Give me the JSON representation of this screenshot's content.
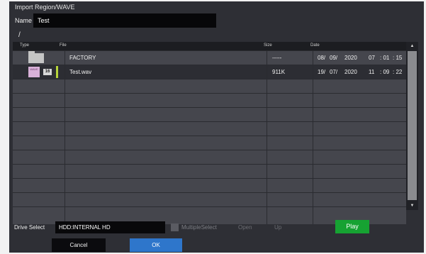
{
  "dialog": {
    "title": "Import Region/WAVE"
  },
  "name": {
    "label": "Name",
    "value": "Test"
  },
  "path": "/",
  "columns": {
    "type": "Type",
    "file": "File",
    "size": "Size",
    "date": "Date"
  },
  "files": [
    {
      "type_icon": "folder-icon",
      "name": "FACTORY",
      "size": "-----",
      "date": {
        "d": "08/",
        "m": "09/",
        "y": "2020",
        "hh": "07",
        "mm": ": 01",
        "ss": ": 15"
      }
    },
    {
      "type_icon": "wave-file-icon",
      "icon_label": "WAVE",
      "bits_badge": "16",
      "name": "Test.wav",
      "size": "911K",
      "date": {
        "d": "19/",
        "m": "07/",
        "y": "2020",
        "hh": "11",
        "mm": ": 09",
        "ss": ": 22"
      }
    }
  ],
  "scrollbar": {
    "up_icon": "arrow-up-icon",
    "down_icon": "arrow-down-icon",
    "up": "▲",
    "down": "▼"
  },
  "footer": {
    "drive_label": "Drive Select",
    "drive_value": "HDD:INTERNAL HD",
    "multiple_select": "MultipleSelect",
    "open": "Open",
    "up": "Up",
    "play": "Play",
    "cancel": "Cancel",
    "ok": "OK"
  },
  "colors": {
    "panel": "#2e2f35",
    "row": "#45464d",
    "play_button": "#16a232",
    "ok_button": "#2e76cb",
    "wave_icon": "#d9b1d9",
    "selection_mark": "#b7d43a"
  }
}
